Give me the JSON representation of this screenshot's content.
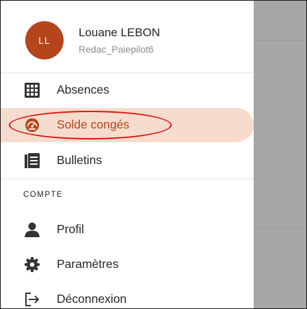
{
  "user": {
    "initials": "LL",
    "name": "Louane LEBON",
    "subtitle": "Redac_Paiepilot6"
  },
  "menu": {
    "items": [
      {
        "label": "Absences",
        "icon": "grid-icon",
        "active": false
      },
      {
        "label": "Solde congés",
        "icon": "gauge-icon",
        "active": true
      },
      {
        "label": "Bulletins",
        "icon": "document-icon",
        "active": false
      }
    ],
    "section_label": "COMPTE",
    "account_items": [
      {
        "label": "Profil",
        "icon": "person-icon"
      },
      {
        "label": "Paramètres",
        "icon": "gear-icon"
      },
      {
        "label": "Déconnexion",
        "icon": "logout-icon"
      }
    ]
  },
  "colors": {
    "avatar": "#b5451b",
    "active_bg": "#f6dccd",
    "active_text": "#b34519",
    "icon": "#333333",
    "overlay": "#a6a6a6",
    "highlight_ring": "#e11414"
  }
}
